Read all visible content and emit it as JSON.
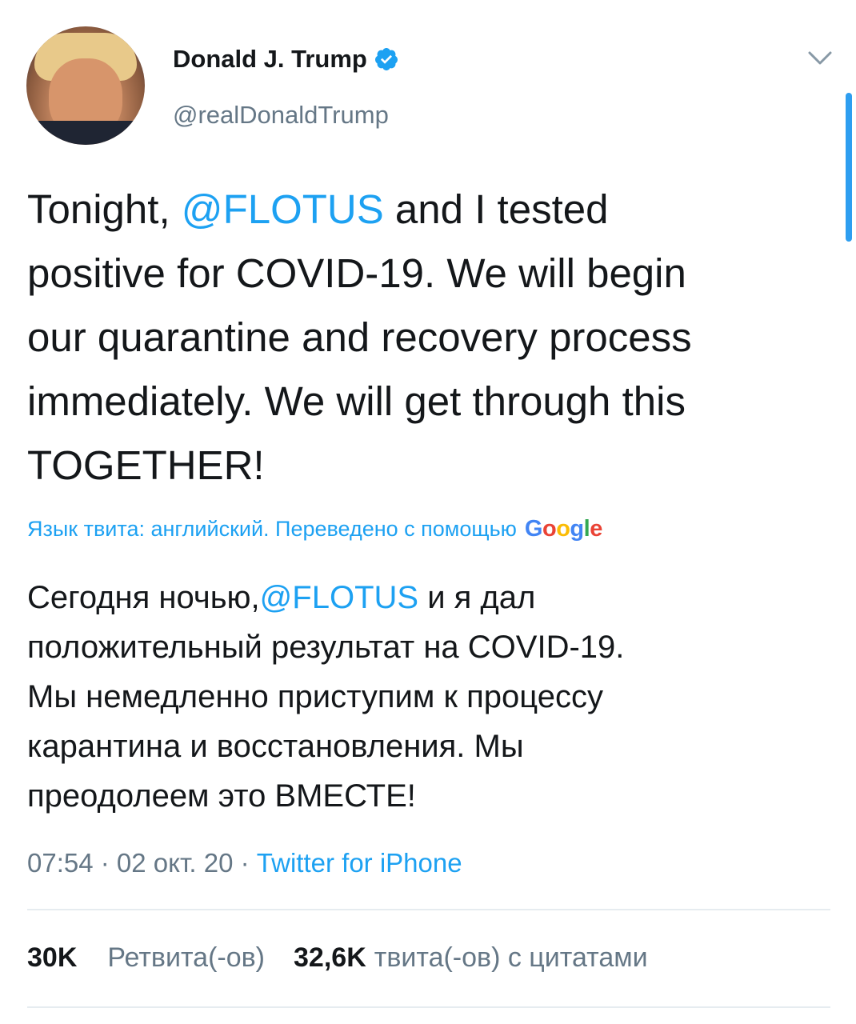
{
  "user": {
    "name": "Donald J. Trump",
    "handle": "@realDonaldTrump"
  },
  "tweet": {
    "text_before_mention": "Tonight, ",
    "mention": "@FLOTUS",
    "text_after_mention": " and I tested\npositive for COVID-19. We will begin\nour quarantine and recovery process\nimmediately. We will get through this\nTOGETHER!"
  },
  "translation": {
    "note": "Язык твита: английский. Переведено с помощью",
    "provider_logo_text": {
      "g1": "G",
      "o1": "o",
      "o2": "o",
      "g2": "g",
      "l": "l",
      "e": "e"
    },
    "text_before_mention": "Сегодня ночью,",
    "mention": "@FLOTUS",
    "text_after_mention": " и я дал\nположительный результат на COVID-19.\nМы немедленно приступим к процессу\nкарантина и восстановления. Мы\nпреодолеем это ВМЕСТЕ!"
  },
  "meta": {
    "time": "07:54",
    "separator": " · ",
    "date": "02 окт. 20",
    "source": "Twitter for iPhone"
  },
  "stats": {
    "retweets_count": "30K",
    "retweets_label": "Ретвита(-ов)",
    "quotes_count": "32,6K",
    "quotes_label": "твита(-ов) с цитатами"
  },
  "colors": {
    "accent": "#1da1f2",
    "secondary_text": "#657786",
    "primary_text": "#14171a"
  }
}
